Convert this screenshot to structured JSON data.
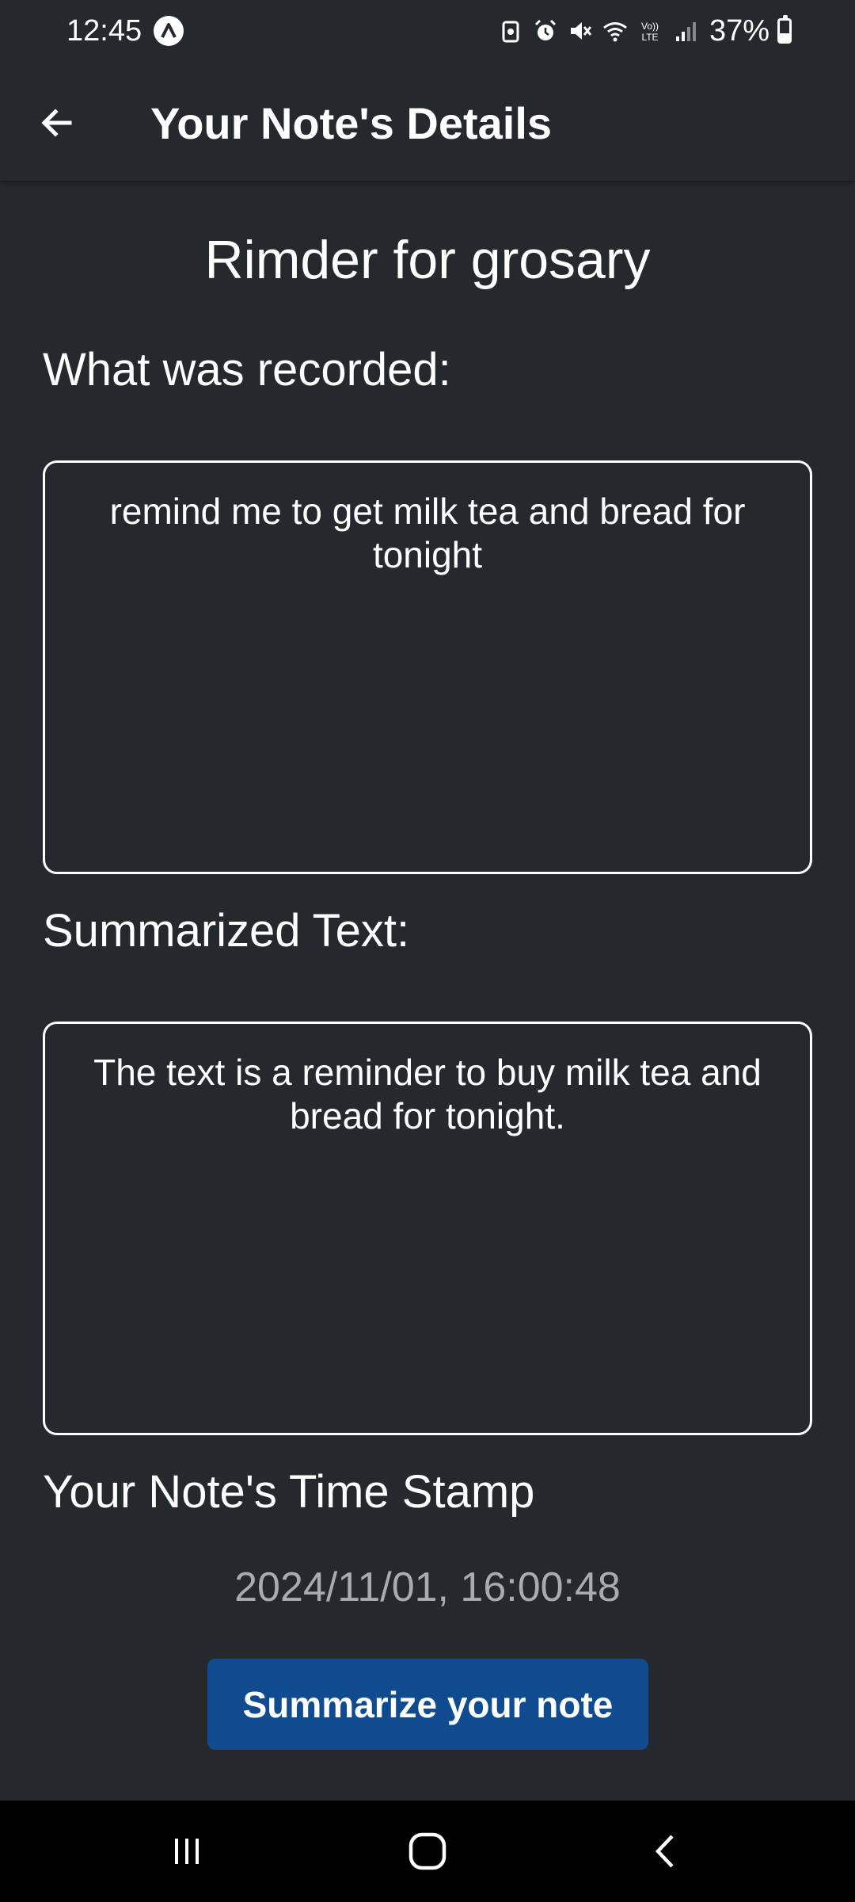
{
  "status_bar": {
    "time": "12:45",
    "battery_percent": "37%",
    "battery_level": 0.37,
    "icons": [
      "app-notification-icon",
      "screenshot-icon",
      "alarm-icon",
      "mute-icon",
      "wifi-icon",
      "volte-icon",
      "signal-icon",
      "battery-icon"
    ]
  },
  "app_bar": {
    "title": "Your Note's Details",
    "back_icon": "arrow-left-icon"
  },
  "note": {
    "title": "Rimder for grosary",
    "recorded_label": "What was recorded:",
    "recorded_text": "remind me to get milk tea and bread for tonight",
    "summary_label": "Summarized Text:",
    "summary_text": "The text is a reminder to buy milk tea and bread for tonight.",
    "timestamp_label": "Your Note's Time Stamp",
    "timestamp_value": "2024/11/01, 16:00:48"
  },
  "actions": {
    "summarize_label": "Summarize your note"
  },
  "nav_bar": {
    "icons": [
      "recent-apps-icon",
      "home-icon",
      "back-nav-icon"
    ]
  },
  "colors": {
    "background": "#25282d",
    "primary_button": "#0f4b8e",
    "timestamp_text": "#a9abae",
    "nav_bar": "#000000"
  }
}
